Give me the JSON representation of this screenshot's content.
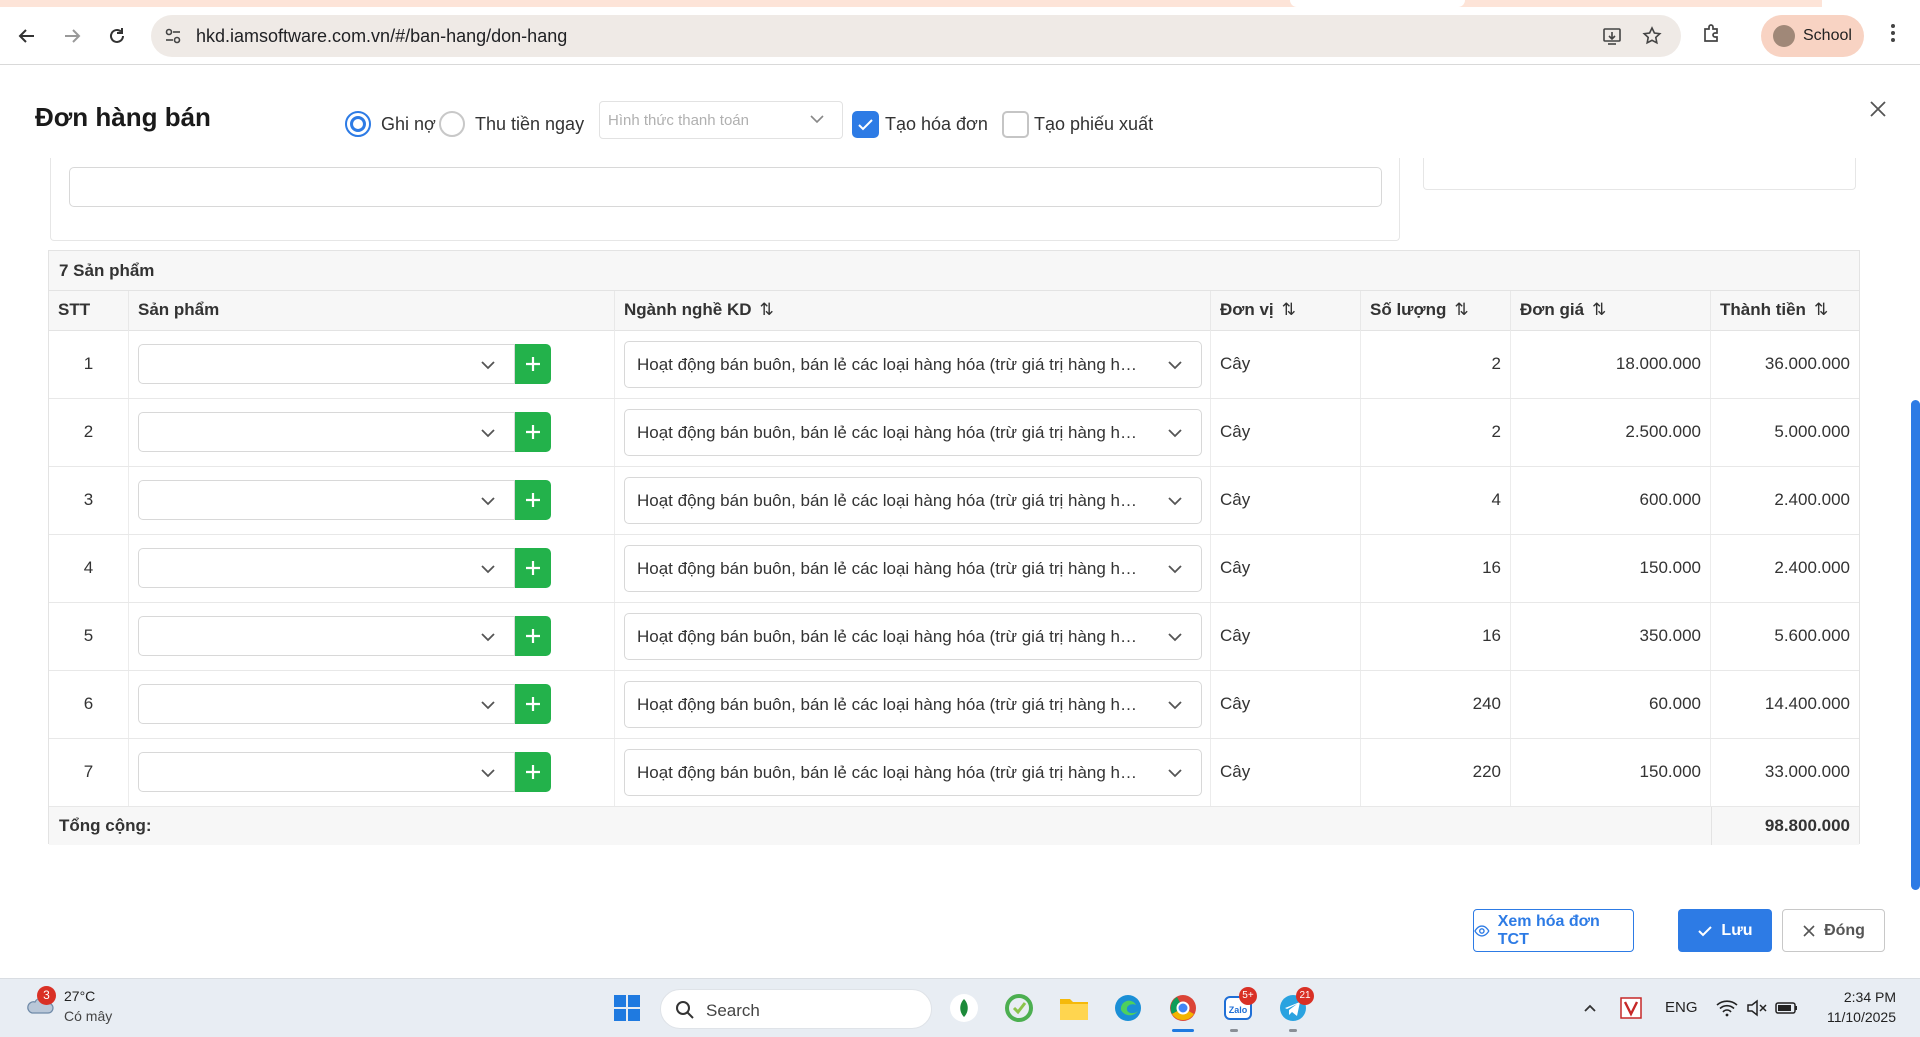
{
  "browser": {
    "url": "hkd.iamsoftware.com.vn/#/ban-hang/don-hang",
    "profile_name": "School"
  },
  "modal": {
    "title": "Đơn hàng bán",
    "radio_debt": "Ghi nợ",
    "radio_cash": "Thu tiền ngay",
    "payment_placeholder": "Hình thức thanh toán",
    "cb_invoice": "Tạo hóa đơn",
    "cb_export": "Tạo phiếu xuất"
  },
  "table": {
    "count_label": "7 Sản phẩm",
    "headers": {
      "stt": "STT",
      "product": "Sản phẩm",
      "industry": "Ngành nghề KD",
      "unit": "Đơn vị",
      "qty": "Số lượng",
      "price": "Đơn giá",
      "amount": "Thành tiền"
    },
    "sort_icon": "⇅",
    "rows": [
      {
        "stt": "1",
        "industry": "Hoạt động bán buôn, bán lẻ các loại hàng hóa (trừ giá trị hàng hóa đại lý bán đúng giá)",
        "unit": "Cây",
        "qty": "2",
        "price": "18.000.000",
        "amount": "36.000.000"
      },
      {
        "stt": "2",
        "industry": "Hoạt động bán buôn, bán lẻ các loại hàng hóa (trừ giá trị hàng hóa đại lý bán đúng giá)",
        "unit": "Cây",
        "qty": "2",
        "price": "2.500.000",
        "amount": "5.000.000"
      },
      {
        "stt": "3",
        "industry": "Hoạt động bán buôn, bán lẻ các loại hàng hóa (trừ giá trị hàng hóa đại lý bán đúng giá)",
        "unit": "Cây",
        "qty": "4",
        "price": "600.000",
        "amount": "2.400.000"
      },
      {
        "stt": "4",
        "industry": "Hoạt động bán buôn, bán lẻ các loại hàng hóa (trừ giá trị hàng hóa đại lý bán đúng giá)",
        "unit": "Cây",
        "qty": "16",
        "price": "150.000",
        "amount": "2.400.000"
      },
      {
        "stt": "5",
        "industry": "Hoạt động bán buôn, bán lẻ các loại hàng hóa (trừ giá trị hàng hóa đại lý bán đúng giá)",
        "unit": "Cây",
        "qty": "16",
        "price": "350.000",
        "amount": "5.600.000"
      },
      {
        "stt": "6",
        "industry": "Hoạt động bán buôn, bán lẻ các loại hàng hóa (trừ giá trị hàng hóa đại lý bán đúng giá)",
        "unit": "Cây",
        "qty": "240",
        "price": "60.000",
        "amount": "14.400.000"
      },
      {
        "stt": "7",
        "industry": "Hoạt động bán buôn, bán lẻ các loại hàng hóa (trừ giá trị hàng hóa đại lý bán đúng giá)",
        "unit": "Cây",
        "qty": "220",
        "price": "150.000",
        "amount": "33.000.000"
      }
    ],
    "total_label": "Tổng cộng:",
    "total_value": "98.800.000"
  },
  "buttons": {
    "view_invoice": "Xem hóa đơn TCT",
    "save": "Lưu",
    "close": "Đóng"
  },
  "taskbar": {
    "weather_temp": "27°C",
    "weather_desc": "Có mây",
    "weather_badge": "3",
    "search_label": "Search",
    "zalo_badge": "5+",
    "telegram_badge": "21",
    "lang": "ENG",
    "time": "2:34 PM",
    "date": "11/10/2025"
  },
  "colors": {
    "primary": "#2d7be5",
    "add_green": "#23b24b"
  }
}
